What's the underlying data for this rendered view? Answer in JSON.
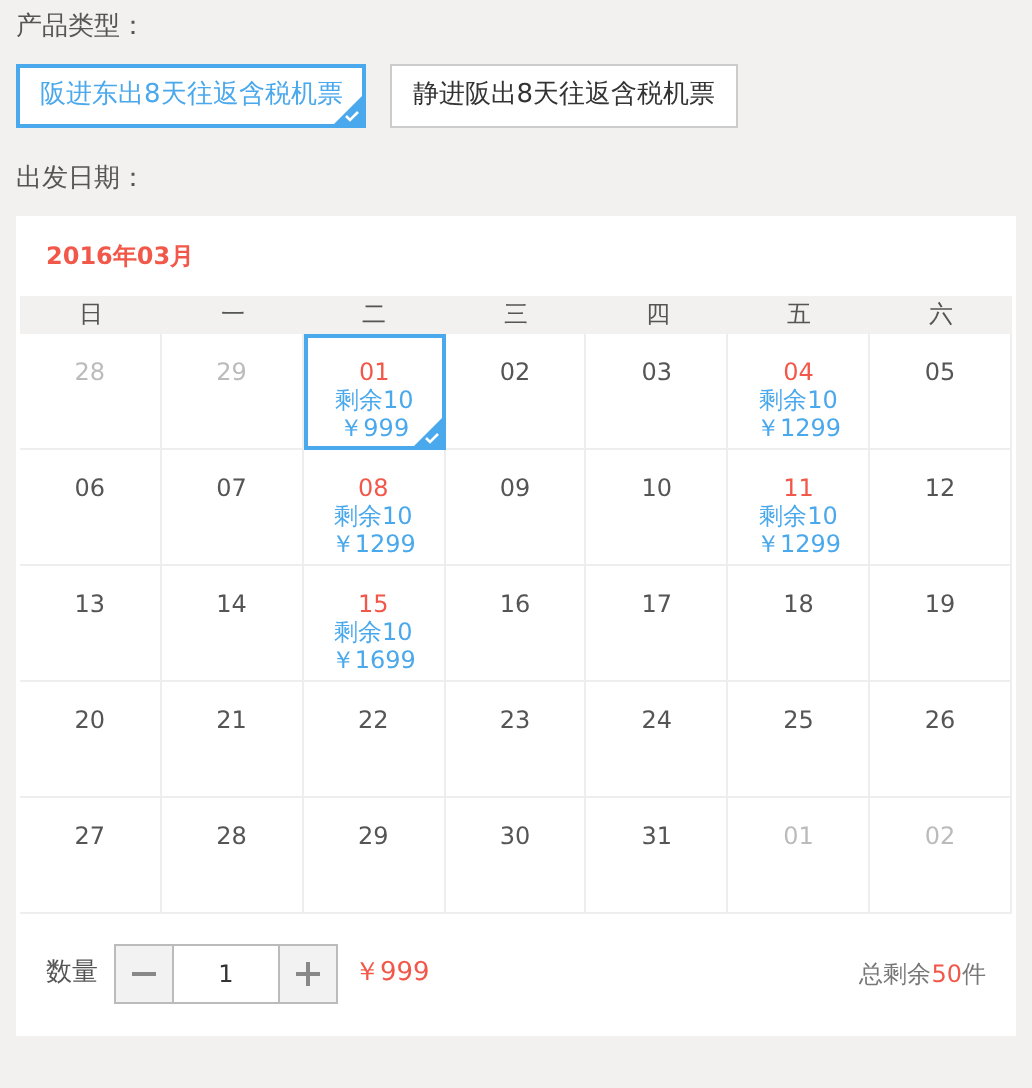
{
  "product_type": {
    "label": "产品类型：",
    "options": [
      {
        "label": "阪进东出8天往返含税机票",
        "selected": true
      },
      {
        "label": "静进阪出8天往返含税机票",
        "selected": false
      }
    ]
  },
  "departure_date": {
    "label": "出发日期：",
    "calendar": {
      "month_title": "2016年03月",
      "weekdays": [
        "日",
        "一",
        "二",
        "三",
        "四",
        "五",
        "六"
      ],
      "weeks": [
        [
          {
            "day": "28",
            "kind": "other",
            "selected": false
          },
          {
            "day": "29",
            "kind": "other",
            "selected": false
          },
          {
            "day": "01",
            "kind": "available",
            "stock": "剩余10",
            "price": "￥999",
            "selected": true
          },
          {
            "day": "02",
            "kind": "normal",
            "selected": false
          },
          {
            "day": "03",
            "kind": "normal",
            "selected": false
          },
          {
            "day": "04",
            "kind": "available",
            "stock": "剩余10",
            "price": "￥1299",
            "selected": false
          },
          {
            "day": "05",
            "kind": "normal",
            "selected": false
          }
        ],
        [
          {
            "day": "06",
            "kind": "normal",
            "selected": false
          },
          {
            "day": "07",
            "kind": "normal",
            "selected": false
          },
          {
            "day": "08",
            "kind": "available",
            "stock": "剩余10",
            "price": "￥1299",
            "selected": false
          },
          {
            "day": "09",
            "kind": "normal",
            "selected": false
          },
          {
            "day": "10",
            "kind": "normal",
            "selected": false
          },
          {
            "day": "11",
            "kind": "available",
            "stock": "剩余10",
            "price": "￥1299",
            "selected": false
          },
          {
            "day": "12",
            "kind": "normal",
            "selected": false
          }
        ],
        [
          {
            "day": "13",
            "kind": "normal",
            "selected": false
          },
          {
            "day": "14",
            "kind": "normal",
            "selected": false
          },
          {
            "day": "15",
            "kind": "available",
            "stock": "剩余10",
            "price": "￥1699",
            "selected": false
          },
          {
            "day": "16",
            "kind": "normal",
            "selected": false
          },
          {
            "day": "17",
            "kind": "normal",
            "selected": false
          },
          {
            "day": "18",
            "kind": "normal",
            "selected": false
          },
          {
            "day": "19",
            "kind": "normal",
            "selected": false
          }
        ],
        [
          {
            "day": "20",
            "kind": "normal",
            "selected": false
          },
          {
            "day": "21",
            "kind": "normal",
            "selected": false
          },
          {
            "day": "22",
            "kind": "normal",
            "selected": false
          },
          {
            "day": "23",
            "kind": "normal",
            "selected": false
          },
          {
            "day": "24",
            "kind": "normal",
            "selected": false
          },
          {
            "day": "25",
            "kind": "normal",
            "selected": false
          },
          {
            "day": "26",
            "kind": "normal",
            "selected": false
          }
        ],
        [
          {
            "day": "27",
            "kind": "normal",
            "selected": false
          },
          {
            "day": "28",
            "kind": "normal",
            "selected": false
          },
          {
            "day": "29",
            "kind": "normal",
            "selected": false
          },
          {
            "day": "30",
            "kind": "normal",
            "selected": false
          },
          {
            "day": "31",
            "kind": "normal",
            "selected": false
          },
          {
            "day": "01",
            "kind": "other",
            "selected": false
          },
          {
            "day": "02",
            "kind": "other",
            "selected": false
          }
        ]
      ]
    },
    "quantity": {
      "label": "数量",
      "value": "1",
      "price": "￥999",
      "total_prefix": "总剩余",
      "total_count": "50",
      "total_suffix": "件"
    }
  }
}
